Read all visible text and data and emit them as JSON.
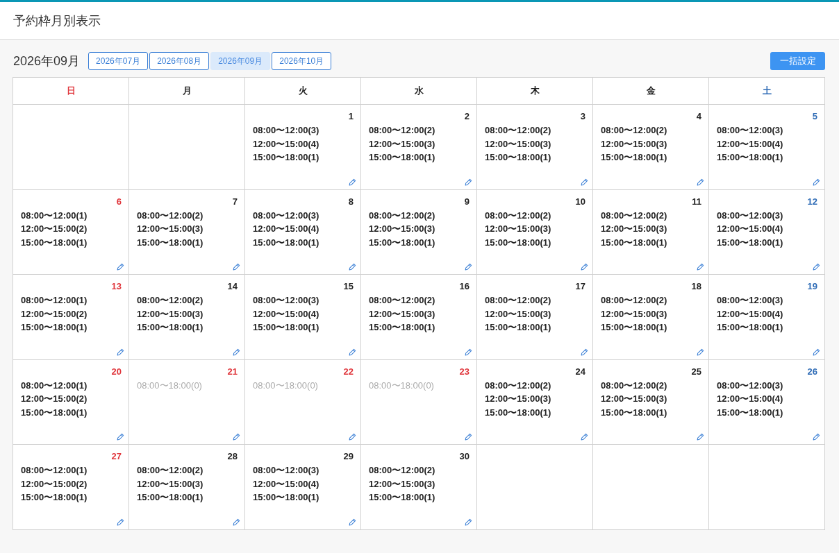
{
  "header": {
    "title": "予約枠月別表示"
  },
  "toolbar": {
    "current_month": "2026年09月",
    "month_buttons": [
      {
        "label": "2026年07月",
        "selected": false
      },
      {
        "label": "2026年08月",
        "selected": false
      },
      {
        "label": "2026年09月",
        "selected": true
      },
      {
        "label": "2026年10月",
        "selected": false
      }
    ],
    "bulk_button": "一括設定"
  },
  "calendar": {
    "weekdays": [
      {
        "label": "日",
        "color": "#e0363c"
      },
      {
        "label": "月",
        "color": "#222222"
      },
      {
        "label": "火",
        "color": "#222222"
      },
      {
        "label": "水",
        "color": "#222222"
      },
      {
        "label": "木",
        "color": "#222222"
      },
      {
        "label": "金",
        "color": "#222222"
      },
      {
        "label": "土",
        "color": "#2f6cb6"
      }
    ],
    "weeks": [
      {
        "days": [
          {
            "kind": "empty"
          },
          {
            "kind": "empty"
          },
          {
            "kind": "day",
            "day": "1",
            "color": "#222222",
            "closed": false,
            "slots": [
              "08:00〜12:00(3)",
              "12:00〜15:00(4)",
              "15:00〜18:00(1)"
            ]
          },
          {
            "kind": "day",
            "day": "2",
            "color": "#222222",
            "closed": false,
            "slots": [
              "08:00〜12:00(2)",
              "12:00〜15:00(3)",
              "15:00〜18:00(1)"
            ]
          },
          {
            "kind": "day",
            "day": "3",
            "color": "#222222",
            "closed": false,
            "slots": [
              "08:00〜12:00(2)",
              "12:00〜15:00(3)",
              "15:00〜18:00(1)"
            ]
          },
          {
            "kind": "day",
            "day": "4",
            "color": "#222222",
            "closed": false,
            "slots": [
              "08:00〜12:00(2)",
              "12:00〜15:00(3)",
              "15:00〜18:00(1)"
            ]
          },
          {
            "kind": "day",
            "day": "5",
            "color": "#2f6cb6",
            "closed": false,
            "slots": [
              "08:00〜12:00(3)",
              "12:00〜15:00(4)",
              "15:00〜18:00(1)"
            ]
          }
        ]
      },
      {
        "days": [
          {
            "kind": "day",
            "day": "6",
            "color": "#e0363c",
            "closed": false,
            "slots": [
              "08:00〜12:00(1)",
              "12:00〜15:00(2)",
              "15:00〜18:00(1)"
            ]
          },
          {
            "kind": "day",
            "day": "7",
            "color": "#222222",
            "closed": false,
            "slots": [
              "08:00〜12:00(2)",
              "12:00〜15:00(3)",
              "15:00〜18:00(1)"
            ]
          },
          {
            "kind": "day",
            "day": "8",
            "color": "#222222",
            "closed": false,
            "slots": [
              "08:00〜12:00(3)",
              "12:00〜15:00(4)",
              "15:00〜18:00(1)"
            ]
          },
          {
            "kind": "day",
            "day": "9",
            "color": "#222222",
            "closed": false,
            "slots": [
              "08:00〜12:00(2)",
              "12:00〜15:00(3)",
              "15:00〜18:00(1)"
            ]
          },
          {
            "kind": "day",
            "day": "10",
            "color": "#222222",
            "closed": false,
            "slots": [
              "08:00〜12:00(2)",
              "12:00〜15:00(3)",
              "15:00〜18:00(1)"
            ]
          },
          {
            "kind": "day",
            "day": "11",
            "color": "#222222",
            "closed": false,
            "slots": [
              "08:00〜12:00(2)",
              "12:00〜15:00(3)",
              "15:00〜18:00(1)"
            ]
          },
          {
            "kind": "day",
            "day": "12",
            "color": "#2f6cb6",
            "closed": false,
            "slots": [
              "08:00〜12:00(3)",
              "12:00〜15:00(4)",
              "15:00〜18:00(1)"
            ]
          }
        ]
      },
      {
        "days": [
          {
            "kind": "day",
            "day": "13",
            "color": "#e0363c",
            "closed": false,
            "slots": [
              "08:00〜12:00(1)",
              "12:00〜15:00(2)",
              "15:00〜18:00(1)"
            ]
          },
          {
            "kind": "day",
            "day": "14",
            "color": "#222222",
            "closed": false,
            "slots": [
              "08:00〜12:00(2)",
              "12:00〜15:00(3)",
              "15:00〜18:00(1)"
            ]
          },
          {
            "kind": "day",
            "day": "15",
            "color": "#222222",
            "closed": false,
            "slots": [
              "08:00〜12:00(3)",
              "12:00〜15:00(4)",
              "15:00〜18:00(1)"
            ]
          },
          {
            "kind": "day",
            "day": "16",
            "color": "#222222",
            "closed": false,
            "slots": [
              "08:00〜12:00(2)",
              "12:00〜15:00(3)",
              "15:00〜18:00(1)"
            ]
          },
          {
            "kind": "day",
            "day": "17",
            "color": "#222222",
            "closed": false,
            "slots": [
              "08:00〜12:00(2)",
              "12:00〜15:00(3)",
              "15:00〜18:00(1)"
            ]
          },
          {
            "kind": "day",
            "day": "18",
            "color": "#222222",
            "closed": false,
            "slots": [
              "08:00〜12:00(2)",
              "12:00〜15:00(3)",
              "15:00〜18:00(1)"
            ]
          },
          {
            "kind": "day",
            "day": "19",
            "color": "#2f6cb6",
            "closed": false,
            "slots": [
              "08:00〜12:00(3)",
              "12:00〜15:00(4)",
              "15:00〜18:00(1)"
            ]
          }
        ]
      },
      {
        "days": [
          {
            "kind": "day",
            "day": "20",
            "color": "#e0363c",
            "closed": false,
            "slots": [
              "08:00〜12:00(1)",
              "12:00〜15:00(2)",
              "15:00〜18:00(1)"
            ]
          },
          {
            "kind": "day",
            "day": "21",
            "color": "#e0363c",
            "closed": true,
            "slots": [
              "08:00〜18:00(0)"
            ]
          },
          {
            "kind": "day",
            "day": "22",
            "color": "#e0363c",
            "closed": true,
            "slots": [
              "08:00〜18:00(0)"
            ]
          },
          {
            "kind": "day",
            "day": "23",
            "color": "#e0363c",
            "closed": true,
            "slots": [
              "08:00〜18:00(0)"
            ]
          },
          {
            "kind": "day",
            "day": "24",
            "color": "#222222",
            "closed": false,
            "slots": [
              "08:00〜12:00(2)",
              "12:00〜15:00(3)",
              "15:00〜18:00(1)"
            ]
          },
          {
            "kind": "day",
            "day": "25",
            "color": "#222222",
            "closed": false,
            "slots": [
              "08:00〜12:00(2)",
              "12:00〜15:00(3)",
              "15:00〜18:00(1)"
            ]
          },
          {
            "kind": "day",
            "day": "26",
            "color": "#2f6cb6",
            "closed": false,
            "slots": [
              "08:00〜12:00(3)",
              "12:00〜15:00(4)",
              "15:00〜18:00(1)"
            ]
          }
        ]
      },
      {
        "days": [
          {
            "kind": "day",
            "day": "27",
            "color": "#e0363c",
            "closed": false,
            "slots": [
              "08:00〜12:00(1)",
              "12:00〜15:00(2)",
              "15:00〜18:00(1)"
            ]
          },
          {
            "kind": "day",
            "day": "28",
            "color": "#222222",
            "closed": false,
            "slots": [
              "08:00〜12:00(2)",
              "12:00〜15:00(3)",
              "15:00〜18:00(1)"
            ]
          },
          {
            "kind": "day",
            "day": "29",
            "color": "#222222",
            "closed": false,
            "slots": [
              "08:00〜12:00(3)",
              "12:00〜15:00(4)",
              "15:00〜18:00(1)"
            ]
          },
          {
            "kind": "day",
            "day": "30",
            "color": "#222222",
            "closed": false,
            "slots": [
              "08:00〜12:00(2)",
              "12:00〜15:00(3)",
              "15:00〜18:00(1)"
            ]
          },
          {
            "kind": "empty"
          },
          {
            "kind": "empty"
          },
          {
            "kind": "empty"
          }
        ]
      }
    ]
  }
}
